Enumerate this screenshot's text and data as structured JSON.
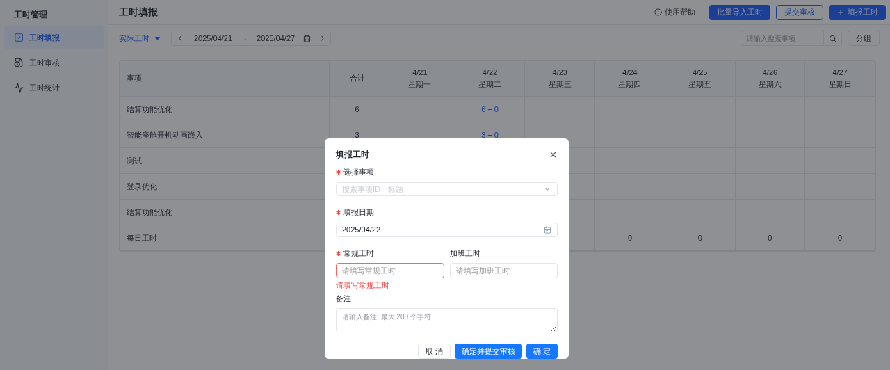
{
  "sidebar": {
    "title": "工时管理",
    "items": [
      {
        "label": "工时填报",
        "selected": true
      },
      {
        "label": "工时审核",
        "selected": false
      },
      {
        "label": "工时统计",
        "selected": false
      }
    ]
  },
  "header": {
    "title": "工时填报",
    "help": "使用帮助",
    "buttons": [
      {
        "label": "批量导入工时",
        "kind": "primary"
      },
      {
        "label": "提交审核",
        "kind": "outline"
      },
      {
        "label": "填报工时",
        "kind": "primary-plus"
      }
    ]
  },
  "toolbar": {
    "mode": "实际工时",
    "start": "2025/04/21",
    "separator": "→",
    "end": "2025/04/27",
    "search": {
      "placeholder": "请输入搜索事项"
    },
    "group": "分组"
  },
  "table": {
    "columns": [
      {
        "line1": "事项"
      },
      {
        "line1": "合计"
      },
      {
        "line1": "4/21",
        "line2": "星期一"
      },
      {
        "line1": "4/22",
        "line2": "星期二"
      },
      {
        "line1": "4/23",
        "line2": "星期三"
      },
      {
        "line1": "4/24",
        "line2": "星期四"
      },
      {
        "line1": "4/25",
        "line2": "星期五"
      },
      {
        "line1": "4/26",
        "line2": "星期六"
      },
      {
        "line1": "4/27",
        "line2": "星期日"
      }
    ],
    "rows": [
      {
        "item": "结算功能优化",
        "total": "6",
        "days": [
          {
            "kind": "blank"
          },
          {
            "kind": "link",
            "text": "6 + 0"
          }
        ]
      },
      {
        "item": "智能座舱开机动画嵌入",
        "total": "3",
        "days": [
          {
            "kind": "blank"
          },
          {
            "kind": "link",
            "text": "3 + 0"
          }
        ]
      },
      {
        "item": "测试"
      },
      {
        "item": "登录优化"
      },
      {
        "item": "结算功能优化"
      },
      {
        "item": "每日工时",
        "days": [
          {
            "kind": "blank"
          },
          {
            "kind": "blank"
          },
          {
            "kind": "blank"
          },
          {
            "kind": "plain",
            "text": "0"
          },
          {
            "kind": "plain",
            "text": "0"
          },
          {
            "kind": "plain",
            "text": "0"
          },
          {
            "kind": "plain",
            "text": "0"
          }
        ]
      }
    ]
  },
  "dialog": {
    "title": "填报工时",
    "item": {
      "label": "选择事项",
      "required": true,
      "placeholder": "搜索事项ID、标题"
    },
    "date": {
      "label": "填报日期",
      "required": true,
      "value": "2025/04/22"
    },
    "regular": {
      "label": "常规工时",
      "required": true,
      "placeholder": "请填写常规工时",
      "error": "请填写常规工时"
    },
    "overtime": {
      "label": "加班工时",
      "required": false,
      "placeholder": "请填写加班工时"
    },
    "note": {
      "label": "备注",
      "placeholder": "请输入备注, 最大 200 个字符"
    },
    "buttons": [
      {
        "label": "取 消",
        "kind": "default"
      },
      {
        "label": "确定并提交审核",
        "kind": "primary"
      },
      {
        "label": "确 定",
        "kind": "primary"
      }
    ]
  }
}
